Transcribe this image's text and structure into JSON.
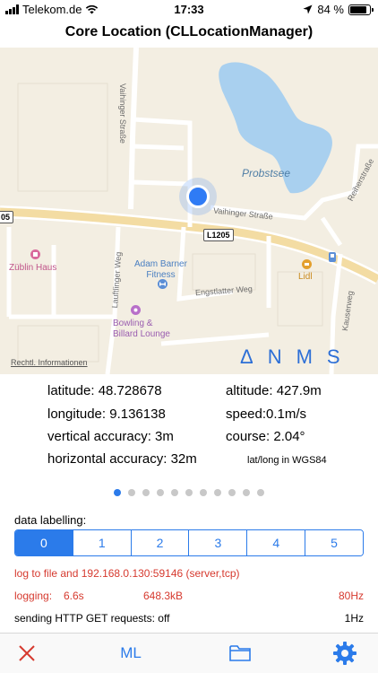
{
  "status_bar": {
    "carrier": "Telekom.de",
    "time": "17:33",
    "battery_percent": "84 %",
    "battery_level": 0.84,
    "icons": [
      "signal-icon",
      "wifi-icon",
      "location-arrow-icon",
      "battery-icon"
    ]
  },
  "nav": {
    "title": "Core Location (CLLocationManager)"
  },
  "map": {
    "lake": "Probstsee",
    "streets": {
      "vaihinger_vertical": "Vaihinger Straße",
      "vaihinger_horizontal": "Vaihinger Straße",
      "lauftlinger": "Lauftlinger Weg",
      "engstlatter": "Engstlatter Weg",
      "kauserweg": "Kauserweg",
      "reiherstrasse": "Reiherstraße"
    },
    "road_badge": "L1205",
    "road_badge_left": "05",
    "pois": {
      "zublin": "Züblin Haus",
      "adam_line1": "Adam Barner",
      "adam_line2": "Fitness",
      "bowling_line1": "Bowling &",
      "bowling_line2": "Billard Lounge",
      "lidl": "Lidl"
    },
    "legal": "Rechtl. Informationen",
    "compass": {
      "delta": "Δ",
      "n": "N",
      "m": "M",
      "s": "S"
    }
  },
  "readings": {
    "latitude": "latitude: 48.728678",
    "longitude": "longitude: 9.136138",
    "vertical_accuracy": "vertical accuracy: 3m",
    "horizontal_accuracy": "horizontal accuracy: 32m",
    "altitude": "altitude: 427.9m",
    "speed": "speed:0.1m/s",
    "course": "course: 2.04°",
    "coord_system": "lat/long in WGS84"
  },
  "pager": {
    "total": 11,
    "active": 0
  },
  "labelling": {
    "title": "data labelling:",
    "options": [
      "0",
      "1",
      "2",
      "3",
      "4",
      "5"
    ],
    "selected": 0
  },
  "log": {
    "target": "log to file and 192.168.0.130:59146 (server,tcp)",
    "logging": "logging:",
    "duration": "6.6s",
    "size": "648.3kB",
    "rate": "80Hz"
  },
  "http": {
    "label": "sending HTTP GET requests: off",
    "rate": "1Hz"
  },
  "toolbar": {
    "close_icon": "close-icon",
    "ml_label": "ML",
    "folder_icon": "folder-icon",
    "settings_icon": "gear-icon"
  },
  "colors": {
    "accent": "#2b7bea",
    "error_red": "#d63a2f",
    "map_bg": "#f3eee2",
    "water": "#a9d0ef"
  }
}
